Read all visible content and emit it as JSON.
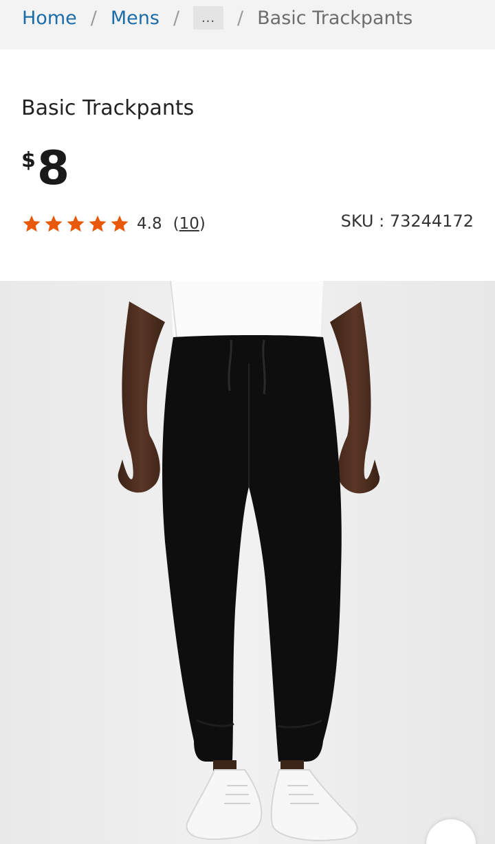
{
  "breadcrumb": {
    "home": "Home",
    "mens": "Mens",
    "ellipsis": "...",
    "separator": "/",
    "current": "Basic Trackpants"
  },
  "product": {
    "title": "Basic Trackpants",
    "currency_symbol": "$",
    "price": "8",
    "rating": {
      "stars": 5,
      "value": "4.8",
      "review_count_open": "(",
      "review_count": "10",
      "review_count_close": ")"
    },
    "sku_label": "SKU : 73244172",
    "image_icon": "trackpants-photo"
  },
  "colors": {
    "link": "#1b6ca8",
    "star": "#e8590c",
    "breadcrumb_bg": "#f3f3f3"
  }
}
